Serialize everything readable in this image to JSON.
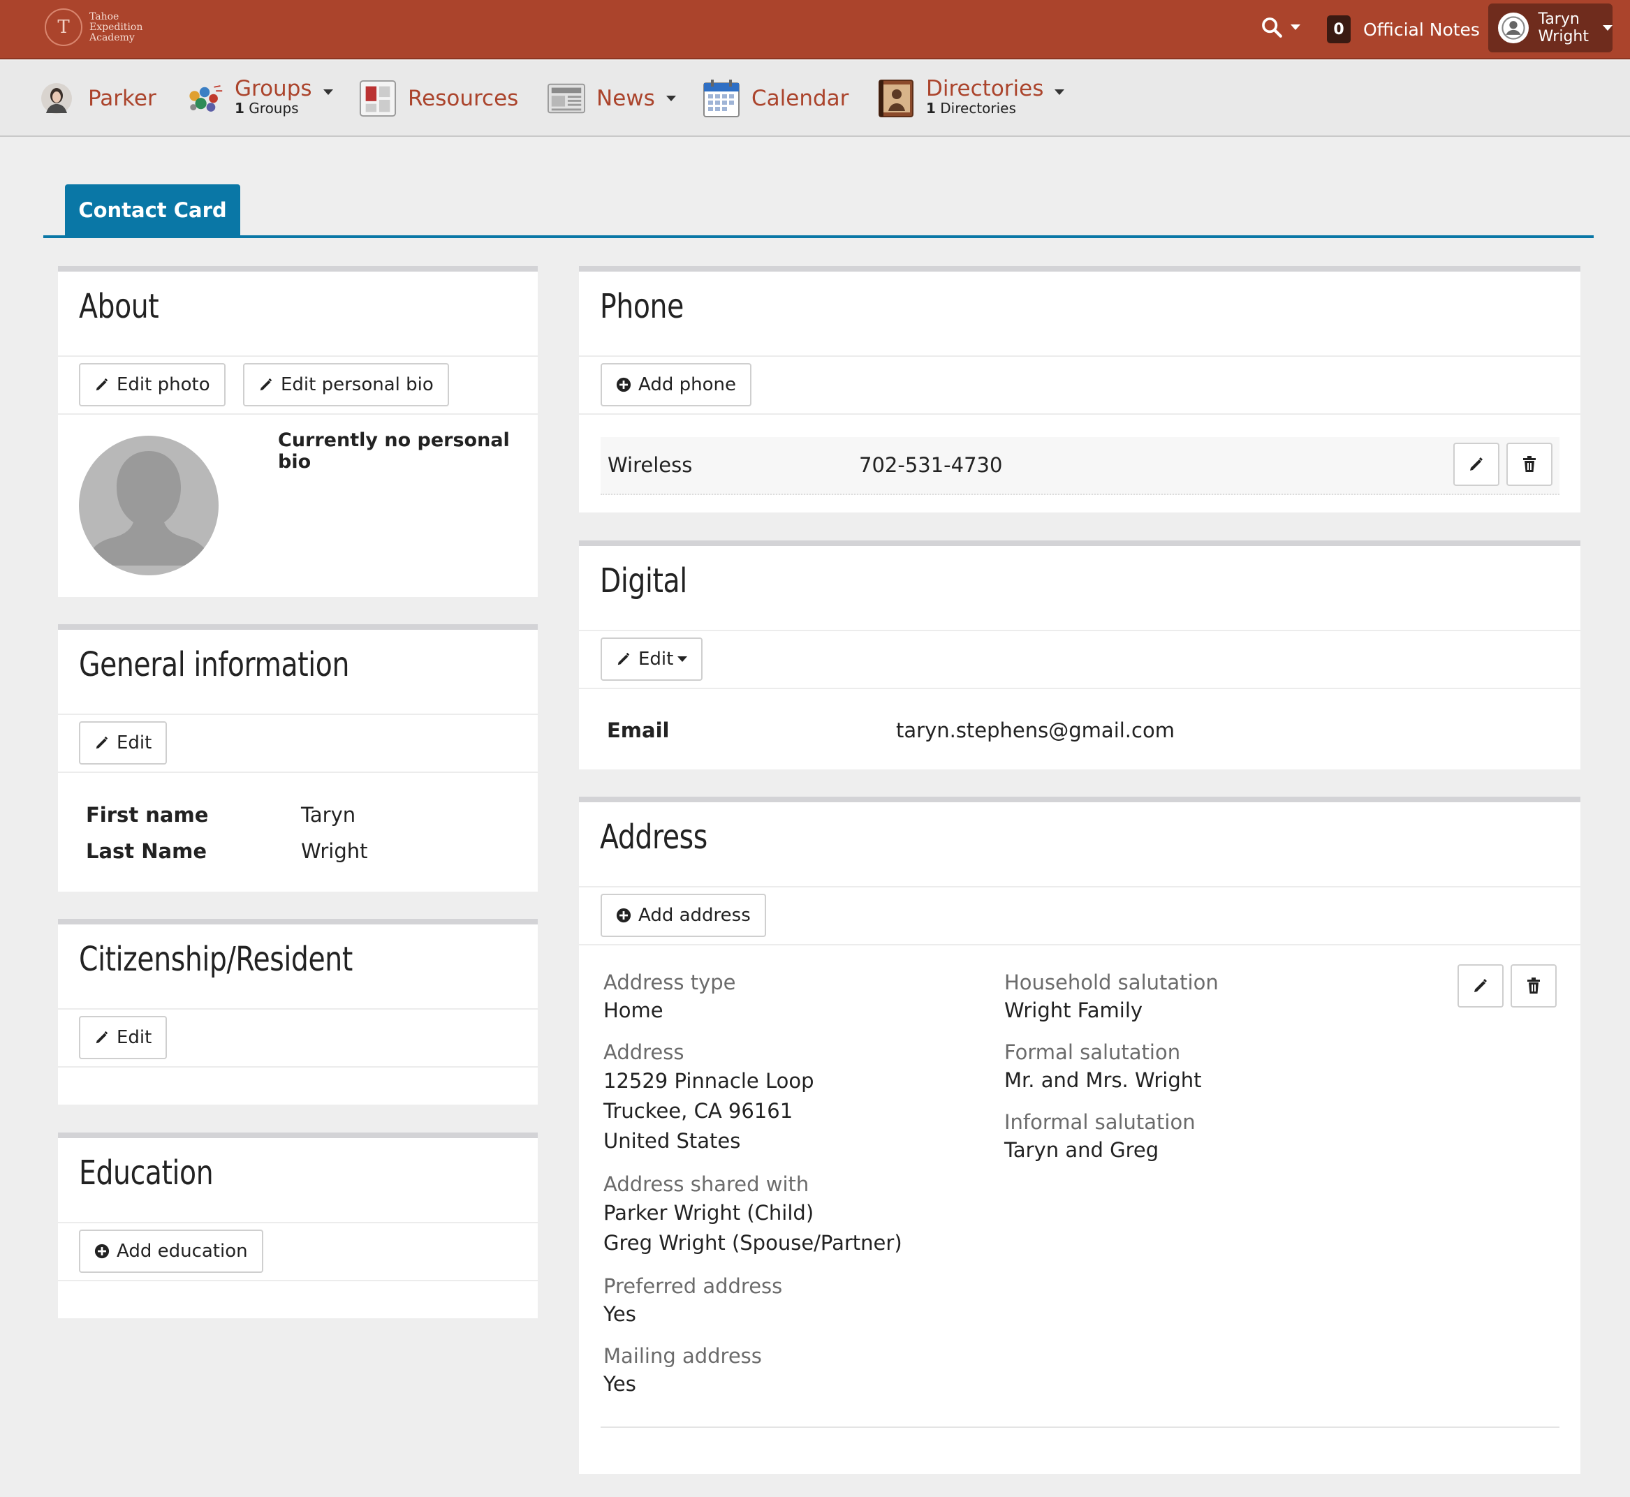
{
  "topbar": {
    "logo_text": [
      "Tahoe",
      "Expedition",
      "Academy"
    ],
    "logo_letter": "T",
    "notes_count": "0",
    "notes_label": "Official Notes",
    "user_first": "Taryn",
    "user_last": "Wright"
  },
  "nav": {
    "parker": "Parker",
    "groups": "Groups",
    "groups_count": "1",
    "groups_sub": "Groups",
    "resources": "Resources",
    "news": "News",
    "calendar": "Calendar",
    "directories": "Directories",
    "directories_count": "1",
    "directories_sub": "Directories"
  },
  "tabs": {
    "contact_card": "Contact Card"
  },
  "about": {
    "title": "About",
    "edit_photo": "Edit photo",
    "edit_bio": "Edit personal bio",
    "bio_text": "Currently no personal bio"
  },
  "general": {
    "title": "General information",
    "edit": "Edit",
    "first_label": "First name",
    "first_value": "Taryn",
    "last_label": "Last Name",
    "last_value": "Wright"
  },
  "citizenship": {
    "title": "Citizenship/Resident",
    "edit": "Edit"
  },
  "education": {
    "title": "Education",
    "add": "Add education"
  },
  "phone": {
    "title": "Phone",
    "add": "Add phone",
    "type": "Wireless",
    "number": "702-531-4730"
  },
  "digital": {
    "title": "Digital",
    "edit": "Edit",
    "email_label": "Email",
    "email_value": "taryn.stephens@gmail.com"
  },
  "address": {
    "title": "Address",
    "add": "Add address",
    "type_label": "Address type",
    "type_value": "Home",
    "address_label": "Address",
    "line1": "12529 Pinnacle Loop",
    "line2": "Truckee, CA 96161",
    "line3": "United States",
    "shared_label": "Address shared with",
    "shared1": "Parker Wright (Child)",
    "shared2": "Greg Wright (Spouse/Partner)",
    "preferred_label": "Preferred address",
    "preferred_value": "Yes",
    "mailing_label": "Mailing address",
    "mailing_value": "Yes",
    "household_label": "Household salutation",
    "household_value": "Wright Family",
    "formal_label": "Formal salutation",
    "formal_value": "Mr. and Mrs. Wright",
    "informal_label": "Informal salutation",
    "informal_value": "Taryn and Greg"
  },
  "colors": {
    "brand": "#ab442c",
    "tab": "#0a77a6"
  }
}
